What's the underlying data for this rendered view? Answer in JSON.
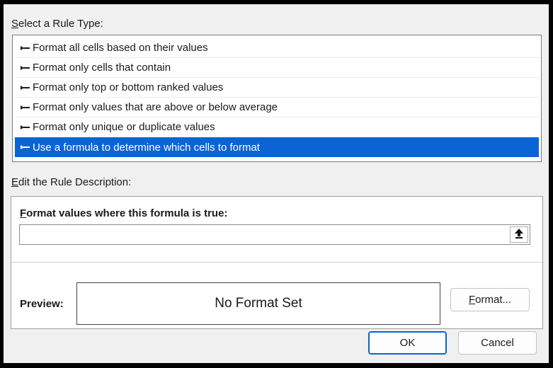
{
  "rule_type_section": {
    "label_first": "S",
    "label_rest": "elect a Rule Type:",
    "items": [
      {
        "label": "Format all cells based on their values",
        "selected": false
      },
      {
        "label": "Format only cells that contain",
        "selected": false
      },
      {
        "label": "Format only top or bottom ranked values",
        "selected": false
      },
      {
        "label": "Format only values that are above or below average",
        "selected": false
      },
      {
        "label": "Format only unique or duplicate values",
        "selected": false
      },
      {
        "label": "Use a formula to determine which cells to format",
        "selected": true
      }
    ]
  },
  "description_section": {
    "label_first": "E",
    "label_rest": "dit the Rule Description:",
    "formula_title_first": "F",
    "formula_title_rest": "ormat values where this formula is true:",
    "formula_value": "",
    "collapse_icon": "collapse-dialog-arrow-up",
    "preview_label": "Preview:",
    "preview_text": "No Format Set",
    "format_button_first": "F",
    "format_button_rest": "ormat..."
  },
  "footer": {
    "ok_label": "OK",
    "cancel_label": "Cancel"
  },
  "colors": {
    "selection": "#0a64d6",
    "dialog_bg": "#f0f0f0"
  }
}
